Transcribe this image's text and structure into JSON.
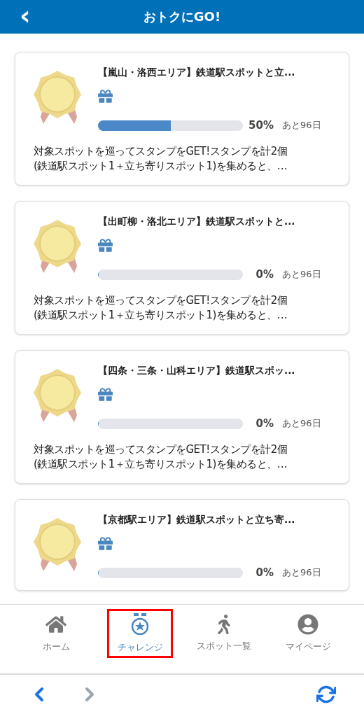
{
  "header": {
    "title": "おトクにGO!",
    "back": "‹"
  },
  "challenges": [
    {
      "title": "【嵐山・洛西エリア】鉄道駅スポットと立...",
      "level": 0.5,
      "percent": "50%",
      "remaining": "あと96日",
      "description": [
        "対象スポットを巡ってスタンプをGET!スタンプを計2個",
        "(鉄道駅スポット1＋立ち寄りスポット1)を集めると、…"
      ]
    },
    {
      "title": "【出町柳・洛北エリア】鉄道駅スポットと...",
      "level": 0,
      "percent": "0%",
      "remaining": "あと96日",
      "description": [
        "対象スポットを巡ってスタンプをGET!スタンプを計2個",
        "(鉄道駅スポット1＋立ち寄りスポット1)を集めると、…"
      ]
    },
    {
      "title": "【四条・三条・山科エリア】鉄道駅スポッ...",
      "level": 0,
      "percent": "0%",
      "remaining": "あと96日",
      "description": [
        "対象スポットを巡ってスタンプをGET!スタンプを計2個",
        "(鉄道駅スポット1＋立ち寄りスポット1)を集めると、…"
      ]
    },
    {
      "title": "【京都駅エリア】鉄道駅スポットと立ち寄...",
      "level": 0,
      "percent": "0%",
      "remaining": "あと96日"
    }
  ],
  "tabs": [
    {
      "kind": "home",
      "label": "ホーム",
      "selected": false,
      "highlighted": false
    },
    {
      "kind": "medal",
      "label": "チャレンジ",
      "selected": true,
      "highlighted": true
    },
    {
      "kind": "walk",
      "label": "スポット一覧",
      "selected": false,
      "highlighted": false
    },
    {
      "kind": "user",
      "label": "マイページ",
      "selected": false,
      "highlighted": false
    }
  ],
  "browser_bar": {
    "back_enabled": true,
    "forward_enabled": false
  }
}
